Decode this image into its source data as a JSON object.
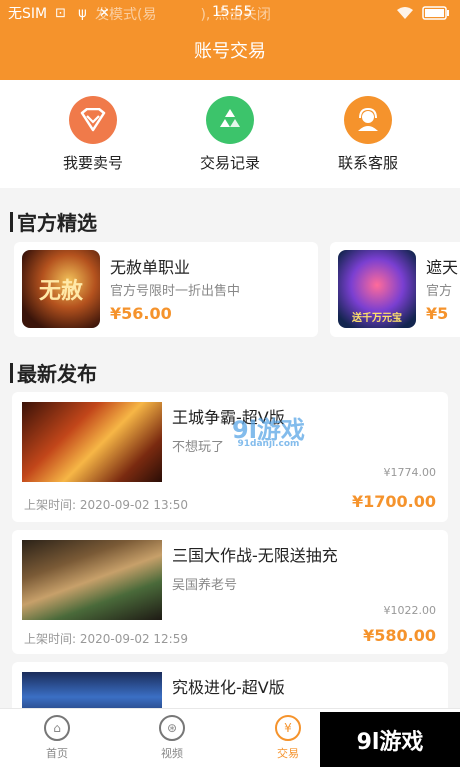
{
  "status_bar": {
    "carrier": "无SIM",
    "notice": "发模式(易",
    "notice2": "), 点击关闭",
    "time": "15:55",
    "icons": "⊡ ψ ✕"
  },
  "header": {
    "title": "账号交易"
  },
  "quick_actions": [
    {
      "label": "我要卖号",
      "icon": "diamond-icon",
      "color": "#f07a4a"
    },
    {
      "label": "交易记录",
      "icon": "recycle-icon",
      "color": "#3cc46b"
    },
    {
      "label": "联系客服",
      "icon": "customer-service-icon",
      "color": "#f5932c"
    }
  ],
  "official": {
    "title": "官方精选",
    "items": [
      {
        "name": "无赦单职业",
        "desc": "官方号限时一折出售中",
        "price": "¥56.00",
        "thumb_text": "无赦"
      },
      {
        "name": "遮天",
        "desc": "官方",
        "price": "¥5",
        "thumb_text": "送千万元宝"
      }
    ]
  },
  "latest": {
    "title": "最新发布",
    "items": [
      {
        "title": "王城争霸-超V版",
        "sub": "不想玩了",
        "orig": "¥1774.00",
        "time": "上架时间: 2020-09-02 13:50",
        "price": "¥1700.00"
      },
      {
        "title": "三国大作战-无限送抽充",
        "sub": "吴国养老号",
        "orig": "¥1022.00",
        "time": "上架时间: 2020-09-02 12:59",
        "price": "¥580.00"
      },
      {
        "title": "究极进化-超V版",
        "sub": "",
        "orig": "",
        "time": "",
        "price": ""
      }
    ]
  },
  "tabs": [
    {
      "label": "首页",
      "icon": "home-icon"
    },
    {
      "label": "视频",
      "icon": "video-reel-icon"
    },
    {
      "label": "交易",
      "icon": "yen-exchange-icon",
      "active": true
    }
  ],
  "watermark": {
    "corner": "9l游戏",
    "mid": "9l游戏",
    "mid_sub": "91danji.com"
  },
  "colors": {
    "accent": "#f5932c",
    "bg": "#f4f4f4"
  }
}
